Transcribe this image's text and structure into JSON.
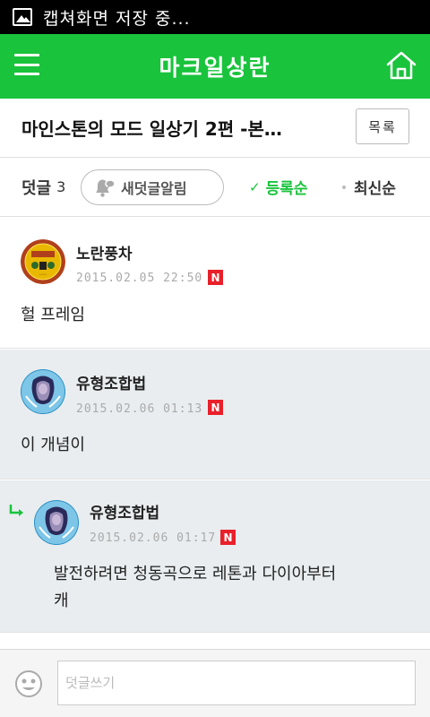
{
  "status_bar": {
    "text": "캡쳐화면 저장 중..."
  },
  "app_bar": {
    "title": "마크일상란"
  },
  "post": {
    "title": "마인스톤의 모드 일상기 2편 -본…",
    "list_button": "목록"
  },
  "sort_bar": {
    "count_label": "덧글",
    "count": "3",
    "alarm_label": "새덧글알림",
    "sort_registered": "등록순",
    "sort_latest": "최신순"
  },
  "comments": [
    {
      "author": "노란풍차",
      "date": "2015.02.05 22:50",
      "badge": "N",
      "body": "헐 프레임",
      "avatar_text": "노란풍차"
    },
    {
      "author": "유형조합법",
      "date": "2015.02.06 01:13",
      "badge": "N",
      "body": "이 개념이"
    },
    {
      "author": "유형조합법",
      "date": "2015.02.06 01:17",
      "badge": "N",
      "body_line1": "발전하려면 청동곡으로 레톤과 다이아부터",
      "body_line2": "캐"
    }
  ],
  "comment_input": {
    "placeholder": "덧글쓰기"
  },
  "colors": {
    "brand": "#19c33c",
    "new_badge": "#e8202a",
    "reply_bg": "#e9edf0"
  }
}
